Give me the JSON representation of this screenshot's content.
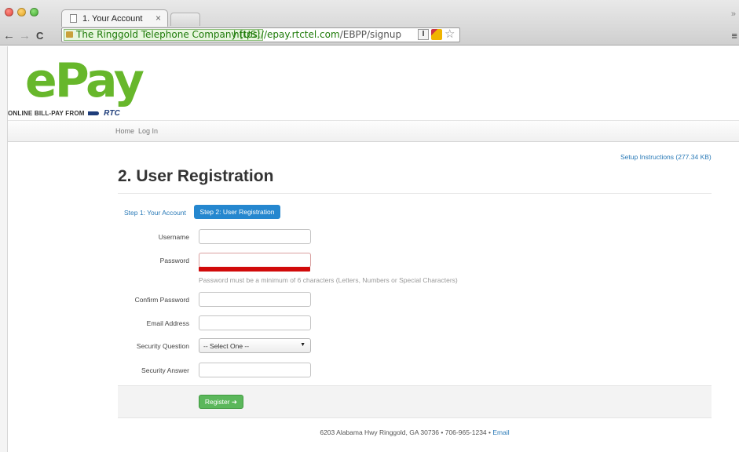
{
  "browser": {
    "tab_title": "1. Your Account",
    "tab_close": "×",
    "secure_label": "The Ringgold Telephone Company [US]",
    "url_host": "https://epay.rtctel.com",
    "url_path": "/EBPP/signup",
    "ext1_label": "I",
    "back_glyph": "←",
    "forward_glyph": "→",
    "reload_glyph": "C",
    "star_glyph": "☆",
    "menu_glyph": "≡",
    "corner_glyph": "»"
  },
  "logo": {
    "wordmark": "ePay",
    "tagline": "ONLINE BILL-PAY FROM",
    "partner": "RTC",
    "color": "#67b72b"
  },
  "nav": {
    "items": [
      "Home",
      "Log In"
    ]
  },
  "setup_link": "Setup Instructions (277.34 KB)",
  "page_title": "2. User Registration",
  "steps": {
    "step1": "Step 1: Your Account",
    "step2": "Step 2: User Registration"
  },
  "form": {
    "username_label": "Username",
    "password_label": "Password",
    "password_help": "Password must be a minimum of 6 characters (Letters, Numbers or Special Characters)",
    "confirm_label": "Confirm Password",
    "email_label": "Email Address",
    "question_label": "Security Question",
    "question_value": "-- Select One --",
    "answer_label": "Security Answer",
    "register_label": "Register ➜"
  },
  "footer": {
    "address": "6203 Alabama Hwy Ringgold, GA 30736 • 706-965-1234 •",
    "email_link": "Email"
  },
  "colors": {
    "accent": "#2587cf",
    "register_green": "#5bb75b",
    "strength_bar": "#d10a0a"
  }
}
